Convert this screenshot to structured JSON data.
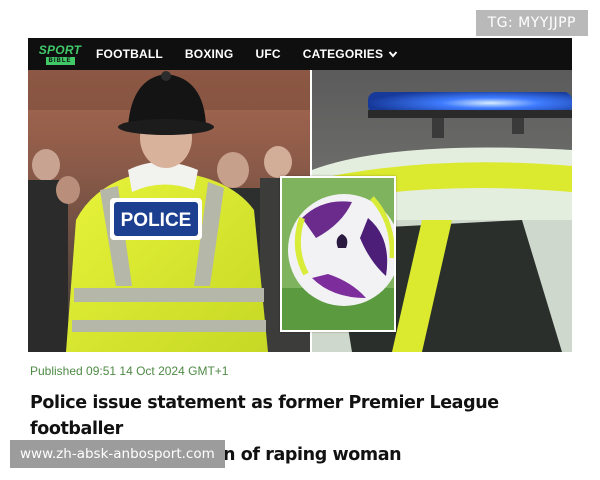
{
  "overlay": {
    "tag": "TG: MYYJJPP",
    "url": "www.zh-absk-anbosport.com"
  },
  "brand": {
    "logo_top": "SPORT",
    "logo_bottom": "BIBLE",
    "accent": "#41c867"
  },
  "nav": {
    "items": [
      "FOOTBALL",
      "BOXING",
      "UFC"
    ],
    "categories_label": "CATEGORIES",
    "categories_icon": "chevron-down-icon"
  },
  "hero": {
    "police_label": "POLICE"
  },
  "article": {
    "published": "Published 09:51 14 Oct 2024 GMT+1",
    "headline_line1": "Police issue statement as former Premier League footballer",
    "headline_line2": "arrested on suspicion of raping woman"
  }
}
